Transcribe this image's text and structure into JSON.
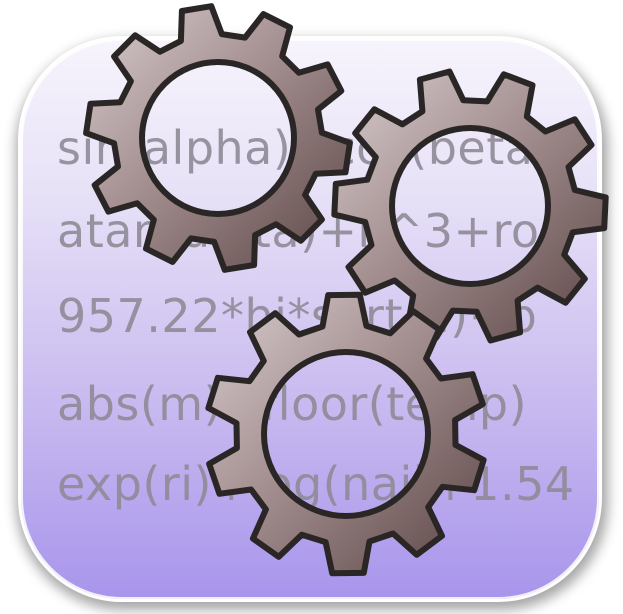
{
  "icon": {
    "name": "expression-calculator-app-icon",
    "formulas": [
      "sin(alpha)+cos(beta)",
      "atan(delta)+k^3+ro",
      "957.22*hi*sqrt(a)+b",
      "abs(m)+floor(temp)",
      "exp(ri)+log(nai)+1.54"
    ]
  },
  "colors": {
    "tile_top": "#f7f4fc",
    "tile_bottom": "#a895ec",
    "gear_light": "#cfc3c4",
    "gear_dark": "#5b4545",
    "gear_outline": "#2b2626",
    "text": "#8f8a96"
  }
}
